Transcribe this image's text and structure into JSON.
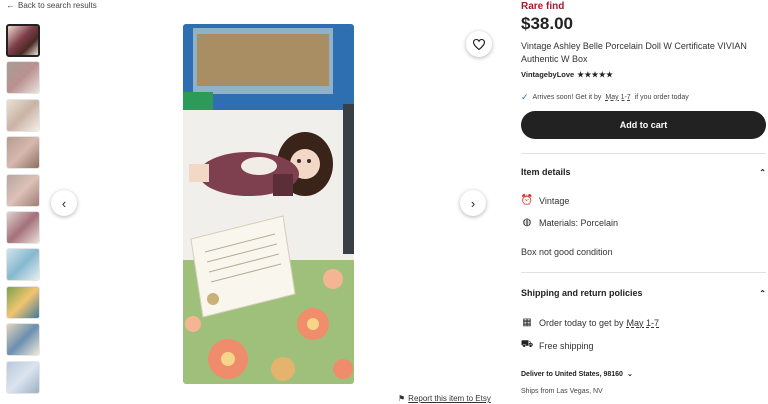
{
  "nav": {
    "back_label": "Back to search results"
  },
  "listing": {
    "badge": "Rare find",
    "price": "$38.00",
    "title": "Vintage Ashley Belle Porcelain Doll W Certificate VIVIAN Authentic W Box",
    "shop": "VintagebyLove",
    "rating": 5,
    "stars": "★★★★★"
  },
  "delivery": {
    "prefix": "Arrives soon! Get it by",
    "dates": "May 1-7",
    "suffix": "if you order today"
  },
  "actions": {
    "add_to_cart": "Add to cart"
  },
  "item_details": {
    "heading": "Item details",
    "rows": [
      {
        "icon": "vintage-icon",
        "label": "Vintage"
      },
      {
        "icon": "materials-icon",
        "label": "Materials: Porcelain"
      }
    ],
    "description": "Box not good condition"
  },
  "shipping": {
    "heading": "Shipping and return policies",
    "order_prefix": "Order today to get by",
    "order_dates": "May 1-7",
    "free_shipping": "Free shipping",
    "deliver_to": "Deliver to United States, 98160",
    "ships_from": "Ships from Las Vegas, NV"
  },
  "gallery": {
    "thumbnail_count": 10,
    "active_index": 0
  },
  "footer": {
    "report": "Report this item to Etsy"
  },
  "colors": {
    "rare": "#a61a2e",
    "cart": "#222222",
    "check": "#2f6fb5"
  }
}
